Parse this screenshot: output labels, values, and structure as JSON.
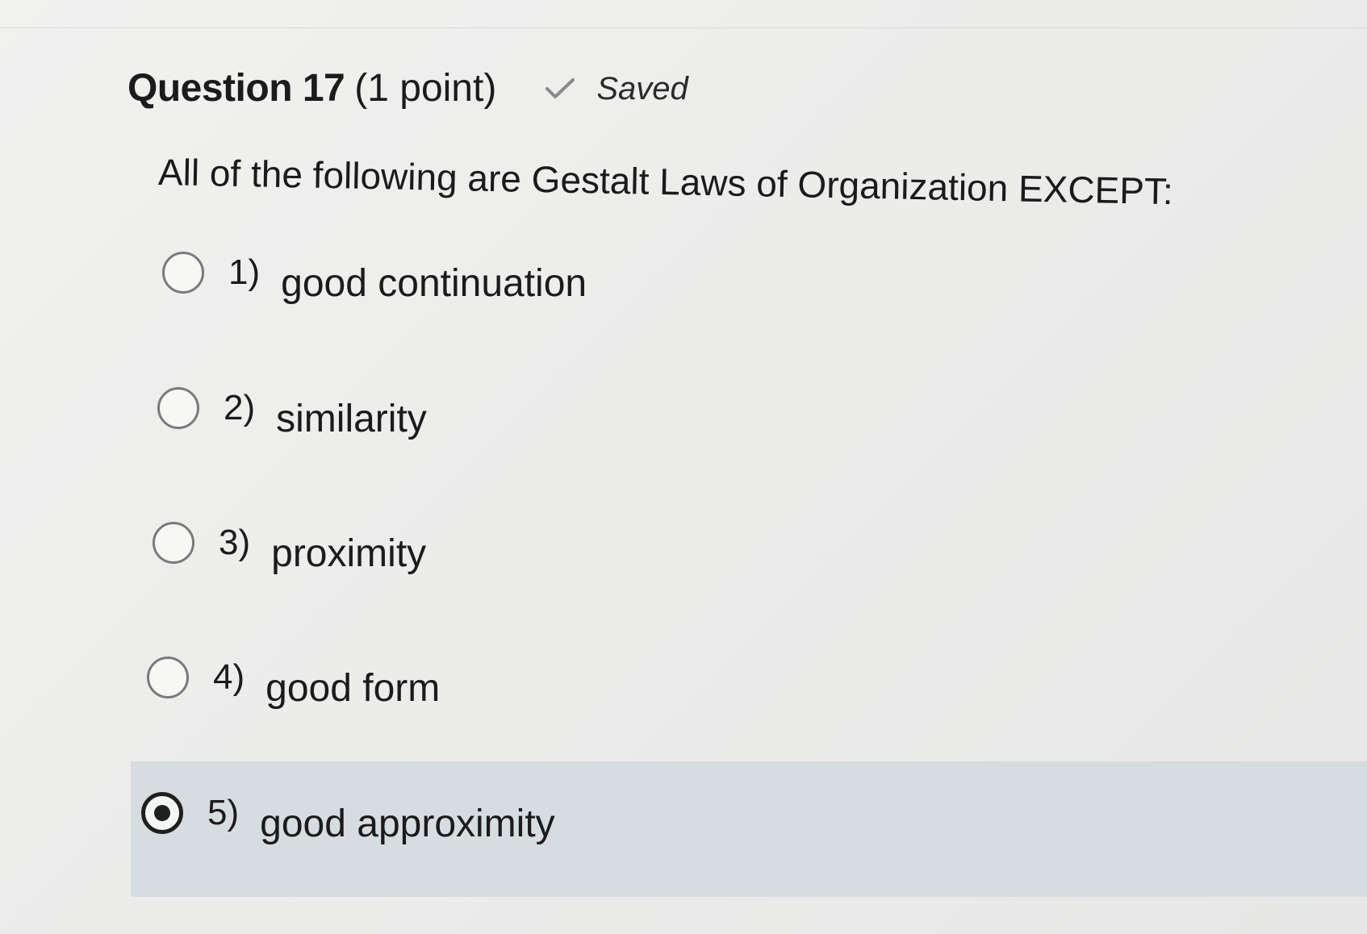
{
  "question": {
    "title": "Question 17",
    "points": "(1 point)",
    "saved_status": "Saved",
    "prompt": "All of the following are Gestalt Laws of Organization EXCEPT:"
  },
  "options": [
    {
      "number": "1)",
      "label": "good continuation",
      "selected": false
    },
    {
      "number": "2)",
      "label": "similarity",
      "selected": false
    },
    {
      "number": "3)",
      "label": "proximity",
      "selected": false
    },
    {
      "number": "4)",
      "label": "good form",
      "selected": false
    },
    {
      "number": "5)",
      "label": "good approximity",
      "selected": true
    }
  ],
  "colors": {
    "selected_highlight": "#d6dde1",
    "check_icon": "#8a8a8a"
  },
  "icons": {
    "saved": "checkmark-icon"
  }
}
